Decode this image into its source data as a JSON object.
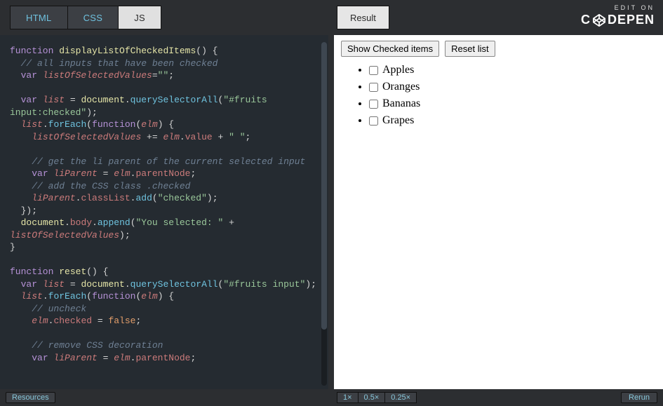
{
  "branding": {
    "edit_on": "EDIT ON",
    "codepen_c": "C",
    "codepen_depen": "DEPEN"
  },
  "tabs": {
    "html": "HTML",
    "css": "CSS",
    "js": "JS",
    "result": "Result"
  },
  "bottom": {
    "resources": "Resources",
    "zoom1": "1×",
    "zoom05": "0.5×",
    "zoom025": "0.25×",
    "rerun": "Rerun"
  },
  "result_panel": {
    "show_btn": "Show Checked items",
    "reset_btn": "Reset list",
    "fruits": [
      "Apples",
      "Oranges",
      "Bananas",
      "Grapes"
    ]
  },
  "code": {
    "l1_fn": "function",
    "l1_name": " displayListOfCheckedItems",
    "l1_tail": "() {",
    "l2": "  // all inputs that have been checked",
    "l3_var": "  var",
    "l3_id": " listOfSelectedValues",
    "l3_tail": "=",
    "l3_str": "\"\"",
    "l3_semi": ";",
    "l5_var": "  var",
    "l5_id": " list",
    "l5_eq": " = ",
    "l5_obj": "document",
    "l5_dot1": ".",
    "l5_fn": "querySelectorAll",
    "l5_open": "(",
    "l5_str": "\"#fruits input:checked\"",
    "l5_close": ");",
    "l6_id": "  list",
    "l6_dot": ".",
    "l6_fn": "forEach",
    "l6_open": "(",
    "l6_kw": "function",
    "l6_mid": "(",
    "l6_arg": "elm",
    "l6_tail": ") {",
    "l7a": "    ",
    "l7_id": "listOfSelectedValues",
    "l7_op": " += ",
    "l7_elm": "elm",
    "l7_dot": ".",
    "l7_prop": "value",
    "l7_plus": " + ",
    "l7_str": "\" \"",
    "l7_semi": ";",
    "l9": "    // get the li parent of the current selected input",
    "l10_var": "    var",
    "l10_id": " liParent",
    "l10_eq": " = ",
    "l10_elm": "elm",
    "l10_dot": ".",
    "l10_prop": "parentNode",
    "l10_semi": ";",
    "l11": "    // add the CSS class .checked",
    "l12_id": "    liParent",
    "l12_dot1": ".",
    "l12_prop": "classList",
    "l12_dot2": ".",
    "l12_fn": "add",
    "l12_open": "(",
    "l12_str": "\"checked\"",
    "l12_close": ");",
    "l13": "  });",
    "l14_obj": "  document",
    "l14_dot1": ".",
    "l14_prop": "body",
    "l14_dot2": ".",
    "l14_fn": "append",
    "l14_open": "(",
    "l14_str": "\"You selected: \"",
    "l14_plus": " + ",
    "l15_id": "listOfSelectedValues",
    "l15_close": ");",
    "l16": "}",
    "l18_fn": "function",
    "l18_name": " reset",
    "l18_tail": "() {",
    "l19_var": "  var",
    "l19_id": " list",
    "l19_eq": " = ",
    "l19_obj": "document",
    "l19_dot": ".",
    "l19_fn": "querySelectorAll",
    "l19_open": "(",
    "l19_str": "\"#fruits input\"",
    "l19_close": ");",
    "l20_id": "  list",
    "l20_dot": ".",
    "l20_fn": "forEach",
    "l20_open": "(",
    "l20_kw": "function",
    "l20_mid": "(",
    "l20_arg": "elm",
    "l20_tail": ") {",
    "l21": "    // uncheck",
    "l22_elm": "    elm",
    "l22_dot": ".",
    "l22_prop": "checked",
    "l22_eq": " = ",
    "l22_bool": "false",
    "l22_semi": ";",
    "l24": "    // remove CSS decoration",
    "l25_var": "    var",
    "l25_id": " liParent",
    "l25_eq": " = ",
    "l25_elm": "elm",
    "l25_dot": ".",
    "l25_prop": "parentNode",
    "l25_semi": ";"
  }
}
